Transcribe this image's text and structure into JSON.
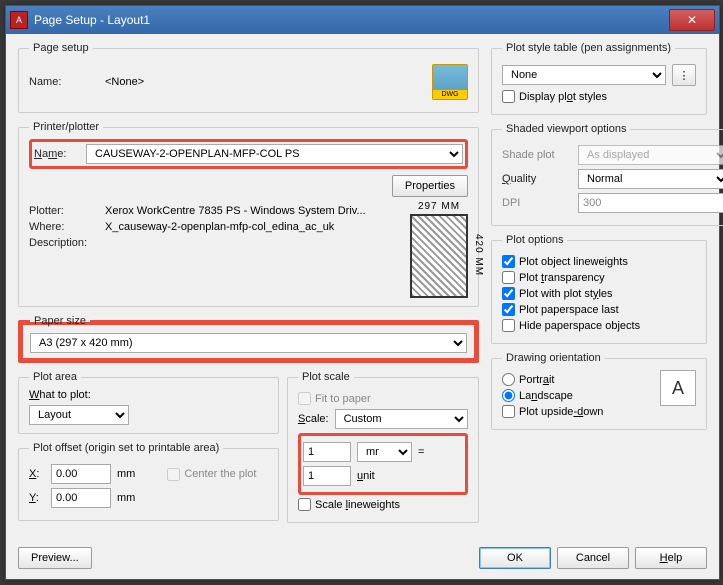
{
  "window": {
    "title": "Page Setup - Layout1"
  },
  "pageSetup": {
    "legend": "Page setup",
    "nameLabel": "Name:",
    "nameValue": "<None>"
  },
  "printer": {
    "legend": "Printer/plotter",
    "nameLabel": "Name:",
    "nameValue": "CAUSEWAY-2-OPENPLAN-MFP-COL PS",
    "propertiesBtn": "Properties",
    "plotterLabel": "Plotter:",
    "plotterValue": "Xerox WorkCentre 7835 PS - Windows System Driv...",
    "whereLabel": "Where:",
    "whereValue": "X_causeway-2-openplan-mfp-col_edina_ac_uk",
    "descLabel": "Description:",
    "paperW": "297 MM",
    "paperH": "420 MM"
  },
  "paperSize": {
    "legend": "Paper size",
    "value": "A3 (297 x 420 mm)"
  },
  "plotArea": {
    "legend": "Plot area",
    "whatLabel": "What to plot:",
    "whatValue": "Layout"
  },
  "plotOffset": {
    "legend": "Plot offset (origin set to printable area)",
    "xLabel": "X:",
    "xValue": "0.00",
    "xUnit": "mm",
    "yLabel": "Y:",
    "yValue": "0.00",
    "yUnit": "mm",
    "centerLabel": "Center the plot"
  },
  "plotScale": {
    "legend": "Plot scale",
    "fitLabel": "Fit to paper",
    "scaleLabel": "Scale:",
    "scaleValue": "Custom",
    "num": "1",
    "numUnit": "mm",
    "den": "1",
    "denUnit": "unit",
    "eq": "=",
    "scaleLw": "Scale lineweights"
  },
  "plotStyle": {
    "legend": "Plot style table (pen assignments)",
    "value": "None",
    "displayLabel": "Display plot styles"
  },
  "shaded": {
    "legend": "Shaded viewport options",
    "shadeLabel": "Shade plot",
    "shadeValue": "As displayed",
    "qualityLabel": "Quality",
    "qualityValue": "Normal",
    "dpiLabel": "DPI",
    "dpiValue": "300"
  },
  "plotOptions": {
    "legend": "Plot options",
    "o1": "Plot object lineweights",
    "o2": "Plot transparency",
    "o3": "Plot with plot styles",
    "o4": "Plot paperspace last",
    "o5": "Hide paperspace objects"
  },
  "orient": {
    "legend": "Drawing orientation",
    "portrait": "Portrait",
    "landscape": "Landscape",
    "upside": "Plot upside-down"
  },
  "footer": {
    "preview": "Preview...",
    "ok": "OK",
    "cancel": "Cancel",
    "help": "Help"
  }
}
